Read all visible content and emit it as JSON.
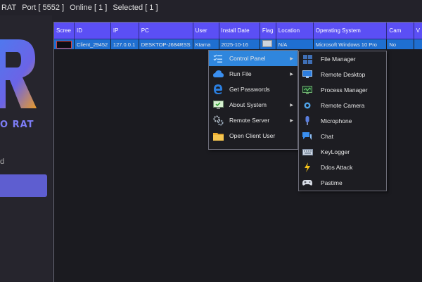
{
  "status": {
    "app_fragment": "RAT",
    "port": "Port [ 5552 ]",
    "online": "Online [ 1 ]",
    "selected": "Selected [ 1 ]"
  },
  "sidebar": {
    "logo_text": "O RAT",
    "sub_text": "d",
    "accent": "#5e5ed0"
  },
  "table": {
    "headers": [
      "Scree",
      "ID",
      "IP",
      "PC",
      "User",
      "Install Date",
      "Flag",
      "Location",
      "Operating System",
      "Cam",
      "V"
    ],
    "rows": [
      {
        "id": "Client_29452",
        "ip": "127.0.0.1",
        "pc": "DESKTOP-J684RSS",
        "user": "Ktama",
        "install_date": "2025-10-16",
        "location": "N/A",
        "os": "Microsoft Windows 10 Pro",
        "cam": "No"
      }
    ]
  },
  "context_menu": {
    "items": [
      {
        "label": "Control Panel",
        "icon": "checklist-icon",
        "has_submenu": true,
        "highlighted": true
      },
      {
        "label": "Run File",
        "icon": "cloud-icon",
        "has_submenu": true
      },
      {
        "label": "Get Passwords",
        "icon": "edge-browser-icon",
        "has_submenu": false
      },
      {
        "label": "About System",
        "icon": "monitor-check-icon",
        "has_submenu": true
      },
      {
        "label": "Remote Server",
        "icon": "gears-icon",
        "has_submenu": true
      },
      {
        "label": "Open Client User",
        "icon": "folder-icon",
        "has_submenu": false
      }
    ]
  },
  "submenu": {
    "items": [
      {
        "label": "File Manager",
        "icon": "windows-icon"
      },
      {
        "label": "Remote Desktop",
        "icon": "remote-desktop-icon"
      },
      {
        "label": "Process Manager",
        "icon": "process-monitor-icon"
      },
      {
        "label": "Remote Camera",
        "icon": "camera-icon"
      },
      {
        "label": "Microphone",
        "icon": "microphone-icon"
      },
      {
        "label": "Chat",
        "icon": "chat-icon"
      },
      {
        "label": "KeyLogger",
        "icon": "keyboard-icon"
      },
      {
        "label": "Ddos Attack",
        "icon": "lightning-icon"
      },
      {
        "label": "Pastime",
        "icon": "gamepad-icon"
      }
    ]
  }
}
